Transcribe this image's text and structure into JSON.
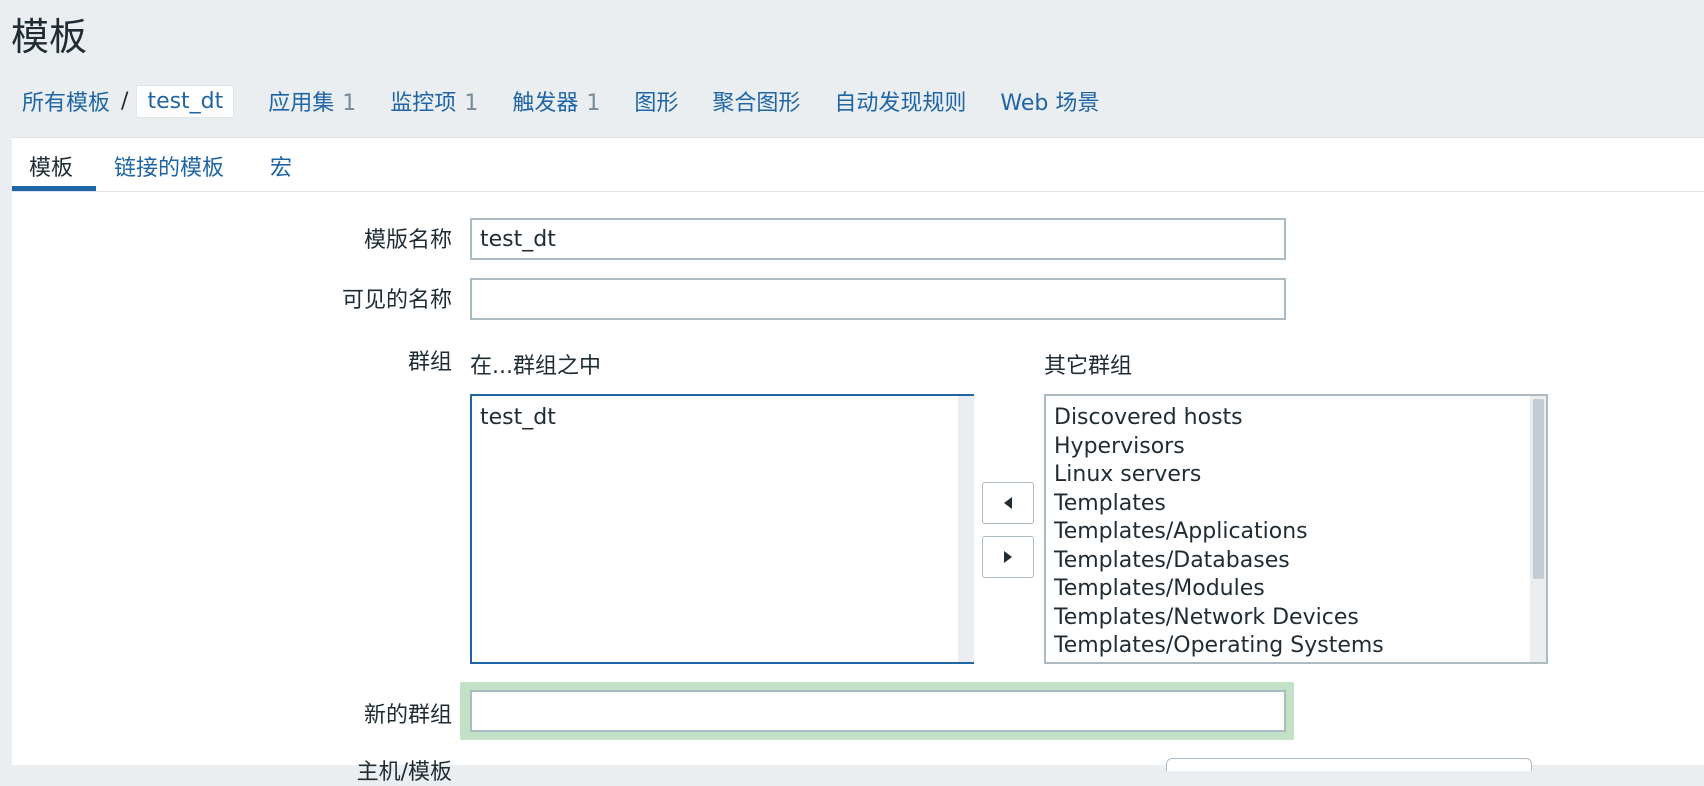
{
  "page": {
    "title": "模板"
  },
  "breadcrumb": {
    "all_templates": "所有模板",
    "separator": "/",
    "current": "test_dt",
    "items": [
      {
        "label": "应用集",
        "count": "1"
      },
      {
        "label": "监控项",
        "count": "1"
      },
      {
        "label": "触发器",
        "count": "1"
      },
      {
        "label": "图形",
        "count": ""
      },
      {
        "label": "聚合图形",
        "count": ""
      },
      {
        "label": "自动发现规则",
        "count": ""
      },
      {
        "label": "Web 场景",
        "count": ""
      }
    ]
  },
  "tabs": [
    {
      "label": "模板",
      "active": true
    },
    {
      "label": "链接的模板",
      "active": false
    },
    {
      "label": "宏",
      "active": false
    }
  ],
  "form": {
    "template_name_label": "模版名称",
    "template_name_value": "test_dt",
    "visible_name_label": "可见的名称",
    "visible_name_value": "",
    "groups_label": "群组",
    "in_groups_label": "在...群组之中",
    "other_groups_label": "其它群组",
    "in_groups": [
      "test_dt"
    ],
    "other_groups": [
      "Discovered hosts",
      "Hypervisors",
      "Linux servers",
      "Templates",
      "Templates/Applications",
      "Templates/Databases",
      "Templates/Modules",
      "Templates/Network Devices",
      "Templates/Operating Systems"
    ],
    "new_group_label": "新的群组",
    "new_group_value": "",
    "hosts_templates_label": "主机/模板"
  },
  "colors": {
    "link": "#1f65a6",
    "text": "#1f2c33",
    "muted": "#768d99",
    "background": "#ebeef0",
    "highlight": "#c3e1c7"
  },
  "icons": {
    "move_left": "triangle-left-icon",
    "move_right": "triangle-right-icon"
  }
}
